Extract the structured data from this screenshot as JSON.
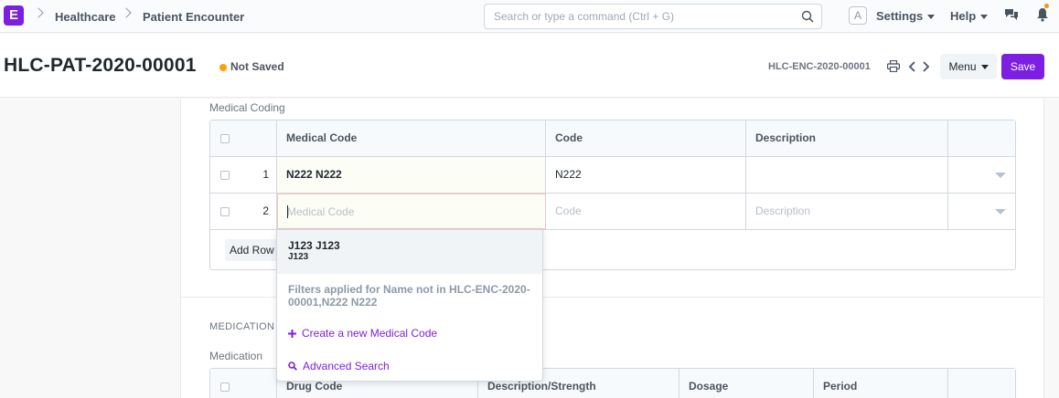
{
  "navbar": {
    "logo_letter": "E",
    "breadcrumbs": [
      "Healthcare",
      "Patient Encounter"
    ],
    "search_placeholder": "Search or type a command (Ctrl + G)",
    "avatar_letter": "A",
    "settings_label": "Settings",
    "help_label": "Help"
  },
  "header": {
    "title": "HLC-PAT-2020-00001",
    "status": "Not Saved",
    "doc_id": "HLC-ENC-2020-00001",
    "menu_label": "Menu",
    "save_label": "Save"
  },
  "medical_coding": {
    "label": "Medical Coding",
    "columns": [
      "Medical Code",
      "Code",
      "Description"
    ],
    "rows": [
      {
        "no": "1",
        "medical_code": "N222 N222",
        "code": "N222",
        "description": ""
      },
      {
        "no": "2",
        "medical_code_placeholder": "Medical Code",
        "code_placeholder": "Code",
        "description_placeholder": "Description"
      }
    ],
    "add_row_label": "Add Row"
  },
  "dropdown": {
    "option_title": "J123 J123",
    "option_sub": "J123",
    "filter_note": "Filters applied for Name not in HLC-ENC-2020-00001,N222 N222",
    "create_label": "Create a new Medical Code",
    "advanced_label": "Advanced Search"
  },
  "medication": {
    "section_title": "MEDICATION",
    "label": "Medication",
    "columns": [
      "Drug Code",
      "Description/Strength",
      "Dosage",
      "Period"
    ]
  },
  "colors": {
    "brand": "#7c1fe3",
    "status_dot": "#ffa00a"
  }
}
